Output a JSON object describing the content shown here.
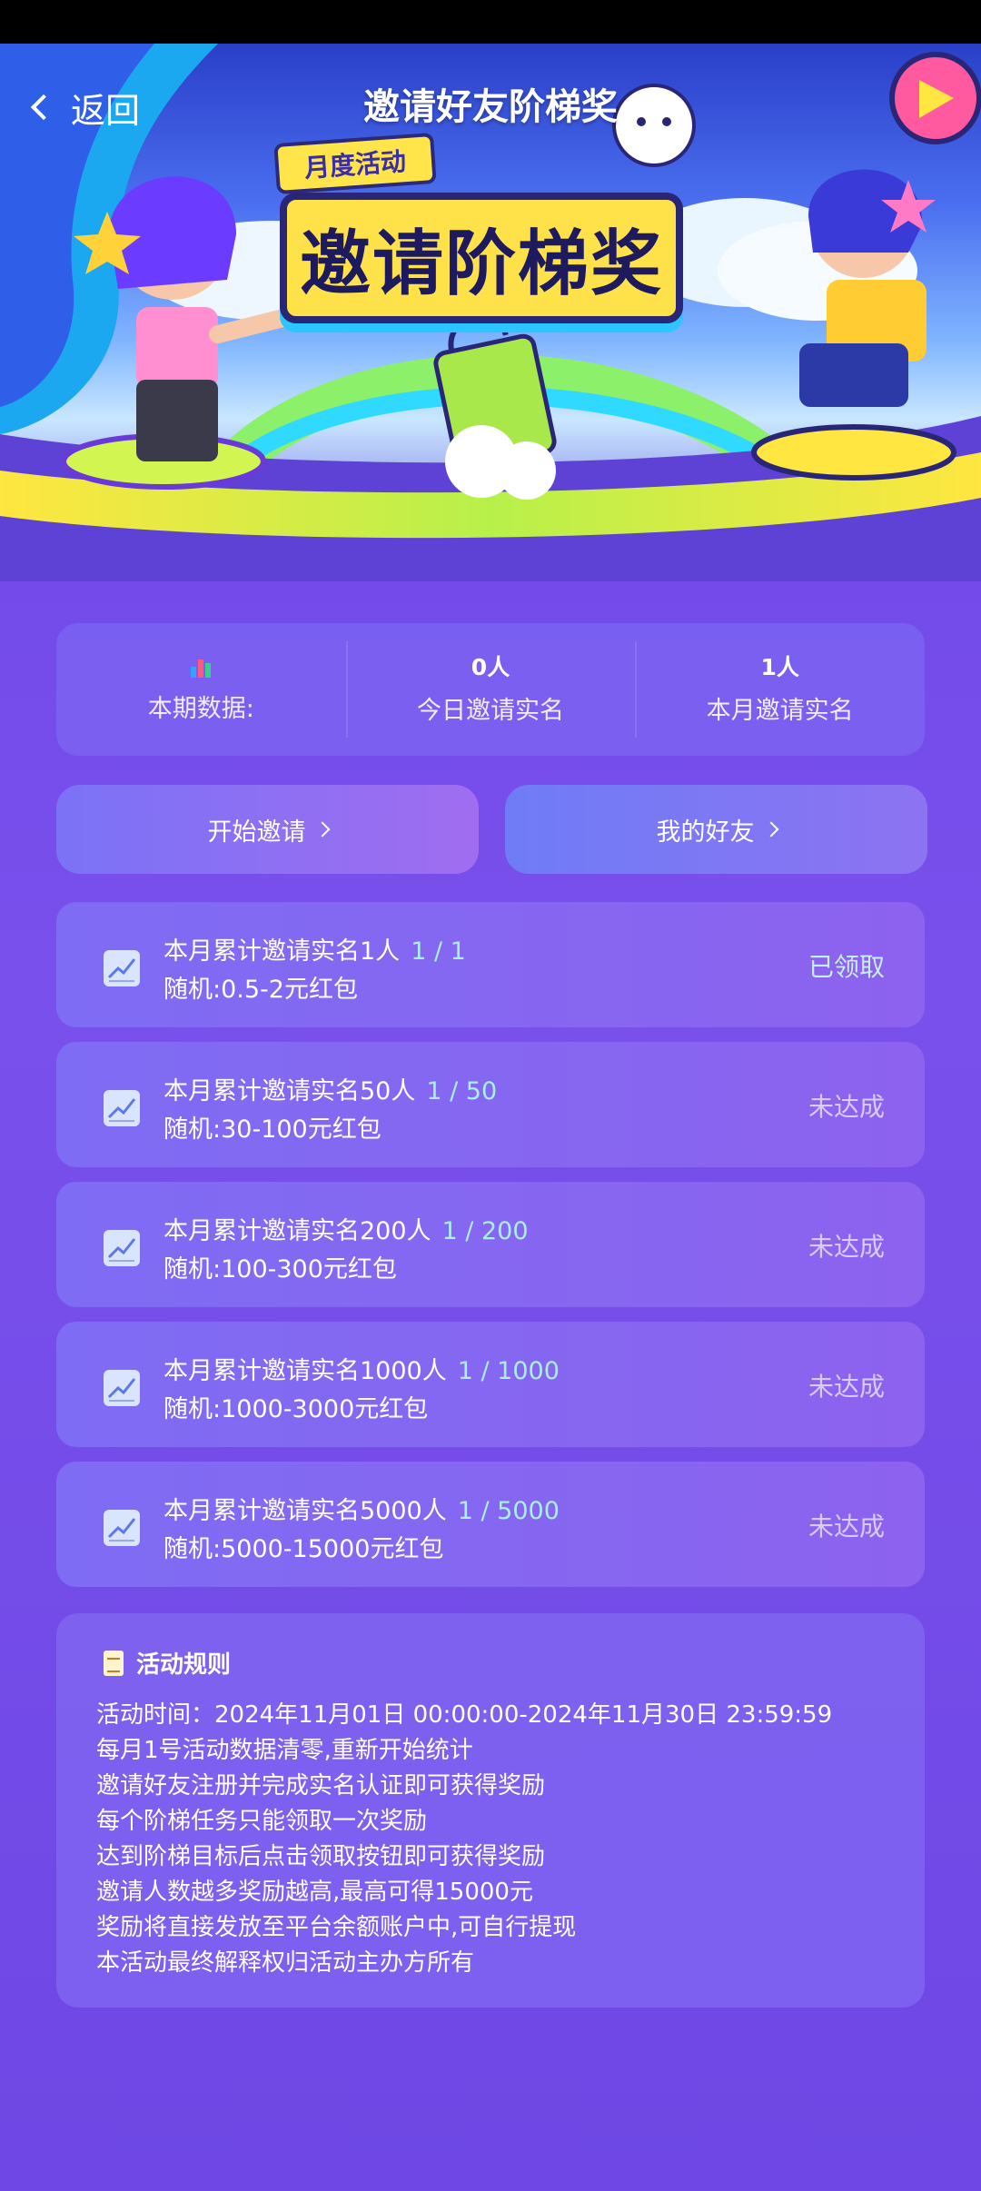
{
  "header": {
    "back_label": "返回",
    "title": "邀请好友阶梯奖"
  },
  "banner": {
    "badge": "月度活动",
    "headline": "邀请阶梯奖"
  },
  "stats": {
    "period_label": "本期数据:",
    "today": {
      "value": "0人",
      "label": "今日邀请实名"
    },
    "month": {
      "value": "1人",
      "label": "本月邀请实名"
    }
  },
  "actions": {
    "invite": "开始邀请",
    "friends": "我的好友"
  },
  "tiers": [
    {
      "title": "本月累计邀请实名1人",
      "progress": "1 / 1",
      "reward": "随机:0.5-2元红包",
      "status": "已领取"
    },
    {
      "title": "本月累计邀请实名50人",
      "progress": "1 / 50",
      "reward": "随机:30-100元红包",
      "status": "未达成"
    },
    {
      "title": "本月累计邀请实名200人",
      "progress": "1 / 200",
      "reward": "随机:100-300元红包",
      "status": "未达成"
    },
    {
      "title": "本月累计邀请实名1000人",
      "progress": "1 / 1000",
      "reward": "随机:1000-3000元红包",
      "status": "未达成"
    },
    {
      "title": "本月累计邀请实名5000人",
      "progress": "1 / 5000",
      "reward": "随机:5000-15000元红包",
      "status": "未达成"
    }
  ],
  "rules": {
    "title": "活动规则",
    "lines": [
      "活动时间：2024年11月01日 00:00:00-2024年11月30日 23:59:59",
      "每月1号活动数据清零,重新开始统计",
      "邀请好友注册并完成实名认证即可获得奖励",
      "每个阶梯任务只能领取一次奖励",
      "达到阶梯目标后点击领取按钮即可获得奖励",
      "邀请人数越多奖励越高,最高可得15000元",
      "奖励将直接发放至平台余额账户中,可自行提现",
      "本活动最终解释权归活动主办方所有"
    ]
  }
}
